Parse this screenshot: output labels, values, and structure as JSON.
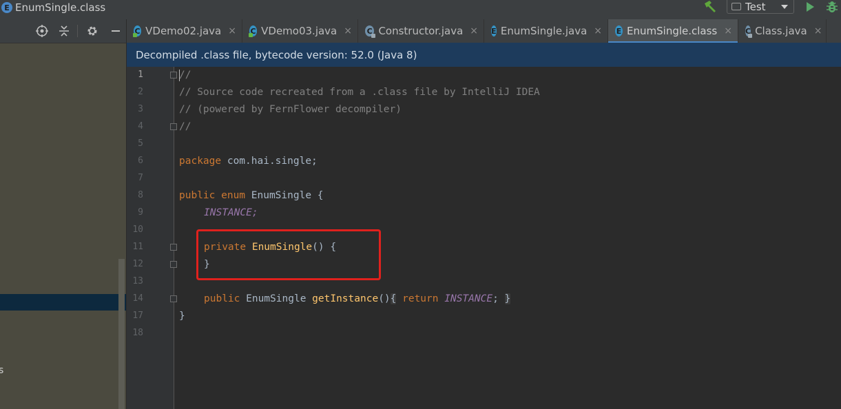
{
  "window": {
    "title": "EnumSingle.class",
    "file_badge": "E"
  },
  "toolbar": {
    "run_config": "Test"
  },
  "project_panel": {
    "tree_fragment": "s"
  },
  "tabs": [
    {
      "label": "VDemo02.java",
      "badge": "C"
    },
    {
      "label": "VDemo03.java",
      "badge": "C"
    },
    {
      "label": "Constructor.java",
      "badge": "C"
    },
    {
      "label": "EnumSingle.java",
      "badge": "E"
    },
    {
      "label": "EnumSingle.class",
      "badge": "E",
      "active": true
    },
    {
      "label": "Class.java",
      "badge": "C"
    }
  ],
  "tab_close_glyph": "×",
  "banner": {
    "text": "Decompiled .class file, bytecode version: 52.0 (Java 8)"
  },
  "gutter": {
    "line_numbers": [
      "1",
      "2",
      "3",
      "4",
      "5",
      "6",
      "7",
      "8",
      "9",
      "10",
      "11",
      "12",
      "13",
      "14",
      "17",
      "18"
    ]
  },
  "code": {
    "l1": "//",
    "l2": "// Source code recreated from a .class file by IntelliJ IDEA",
    "l3": "// (powered by FernFlower decompiler)",
    "l4": "//",
    "l6_kw": "package",
    "l6_rest": " com.hai.single;",
    "l8_kw": "public enum",
    "l8_rest": " EnumSingle {",
    "l9": "INSTANCE;",
    "l11_kw": "private",
    "l11_fn": "EnumSingle",
    "l11_rest": "() {",
    "l12": "}",
    "l14_kw": "public",
    "l14_type": " EnumSingle ",
    "l14_fn": "getInstance",
    "l14_paren": "()",
    "l14_open": "{",
    "l14_kw2": " return ",
    "l14_const": "INSTANCE",
    "l14_semi": ";",
    "l14_close": "}",
    "l17": "}"
  },
  "colors": {
    "keyword": "#cc7832",
    "comment": "#808080",
    "constant": "#9876aa",
    "function": "#ffc66d",
    "accent": "#4a88c7",
    "highlight_box": "#e0211d"
  }
}
